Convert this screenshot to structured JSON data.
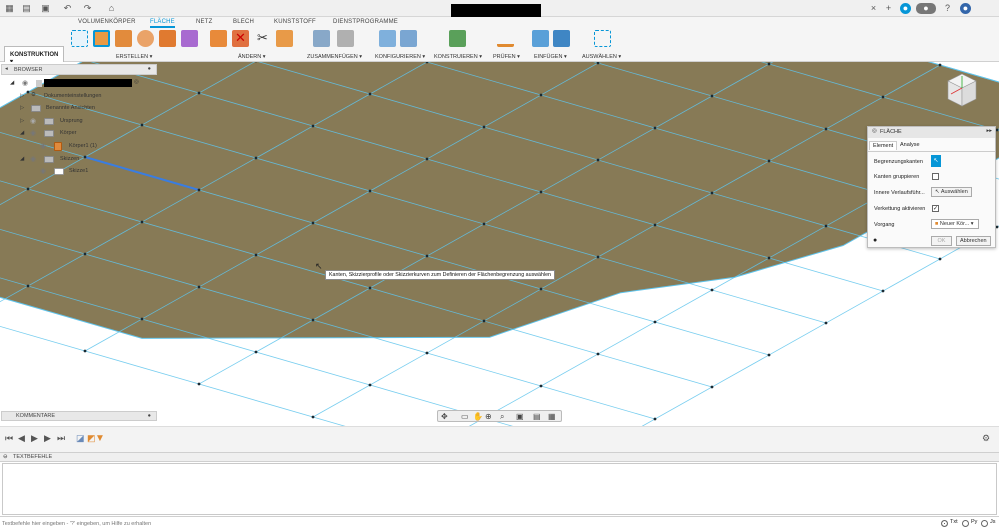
{
  "ribbon": {
    "tabs": [
      "VOLUMENKÖRPER",
      "FLÄCHE",
      "NETZ",
      "BLECH",
      "KUNSTSTOFF",
      "DIENSTPROGRAMME"
    ],
    "active_tab": "FLÄCHE",
    "workspace": "KONSTRUKTION",
    "groups": [
      "ERSTELLEN",
      "ÄNDERN",
      "ZUSAMMENFÜGEN",
      "KONFIGURIEREN",
      "KONSTRUIEREN",
      "PRÜFEN",
      "EINFÜGEN",
      "AUSWÄHLEN"
    ]
  },
  "browser": {
    "title": "BROWSER",
    "items": {
      "doc_settings": "Dokumenteinstellungen",
      "named_views": "Benannte Ansichten",
      "origin": "Ursprung",
      "bodies": "Körper",
      "body1": "Körper1 (1)",
      "sketches": "Skizzen",
      "sketch1": "Skizze1"
    }
  },
  "panel": {
    "title": "FLÄCHE",
    "tabs": [
      "Element",
      "Analyse"
    ],
    "boundary_edges_label": "Begrenzungskanten",
    "group_edges_label": "Kanten gruppieren",
    "group_edges_checked": false,
    "interior_rails_label": "Innere Verlaufsführ...",
    "interior_rails_button": "Auswählen",
    "chaining_label": "Verkettung aktivieren",
    "chaining_checked": true,
    "operation_label": "Vorgang",
    "operation_value": "Neuer Kör...",
    "ok_label": "OK",
    "cancel_label": "Abbrechen"
  },
  "tooltip": "Kanten, Skizzierprofile oder Skizzierkurven zum Definieren der Flächenbegrenzung auswählen",
  "comments": {
    "title": "KOMMENTARE"
  },
  "textcommands": {
    "title": "TEXTBEFEHLE",
    "placeholder": "Textbefehle hier eingeben - '?' eingeben, um Hilfe zu erhalten",
    "languages": [
      "Txt",
      "Py",
      "Js"
    ],
    "selected": "Txt"
  },
  "colors": {
    "accent": "#0696d7",
    "surface_fill": "#877a56",
    "edge": "#5fc4ec",
    "selected_edge": "#3a7de0"
  }
}
